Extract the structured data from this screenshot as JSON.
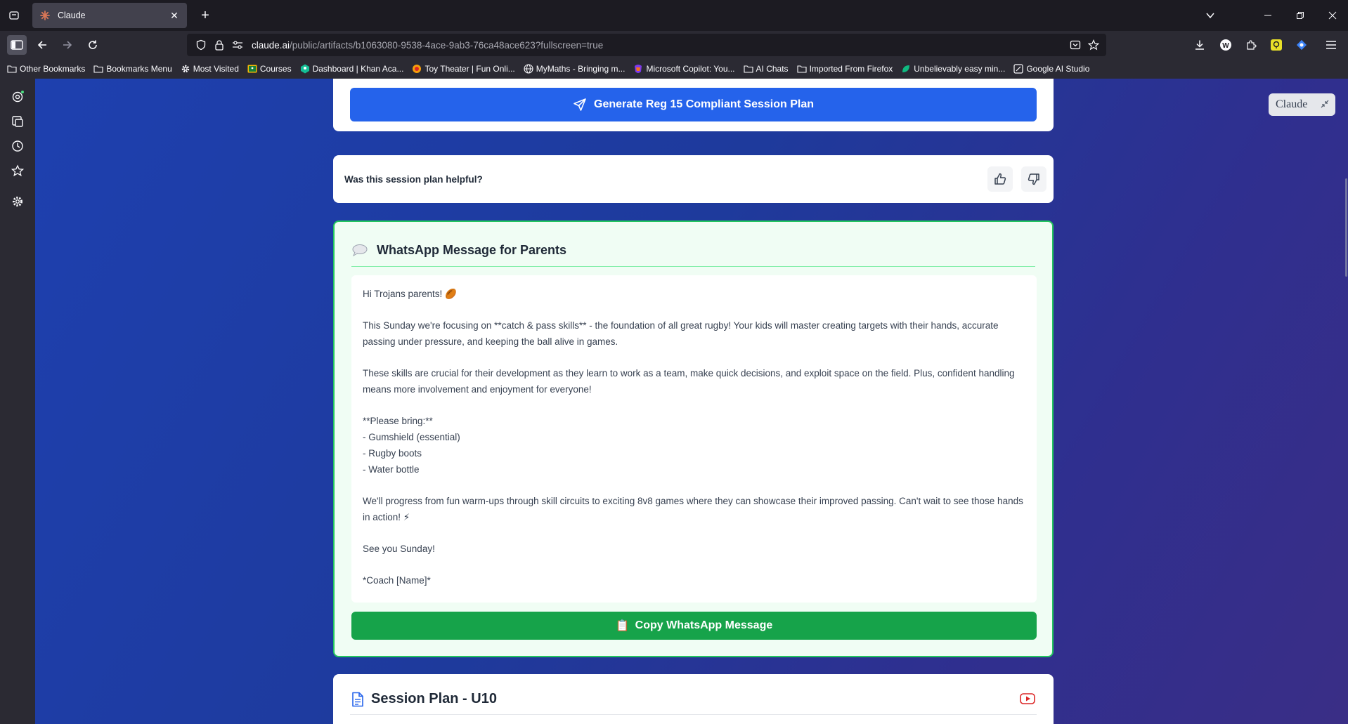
{
  "browser": {
    "tab_title": "Claude",
    "url_host": "claude.ai",
    "url_path": "/public/artifacts/b1063080-9538-4ace-9ab3-76ca48ace623?fullscreen=true",
    "bookmarks": [
      "Other Bookmarks",
      "Bookmarks Menu",
      "Most Visited",
      "Courses",
      "Dashboard | Khan Aca...",
      "Toy Theater | Fun Onli...",
      "MyMaths - Bringing m...",
      "Microsoft Copilot: You...",
      "AI Chats",
      "Imported From Firefox",
      "Unbelievably easy min...",
      "Google AI Studio"
    ]
  },
  "artifact": {
    "badge": "Claude",
    "generate_button": "Generate Reg 15 Compliant Session Plan",
    "feedback_question": "Was this session plan helpful?",
    "whatsapp": {
      "title": "WhatsApp Message for Parents",
      "lines": {
        "greeting": "Hi Trojans parents! 🏉",
        "p1": "This Sunday we're focusing on **catch & pass skills** - the foundation of all great rugby! Your kids will master creating targets with their hands, accurate passing under pressure, and keeping the ball alive in games.",
        "p2": "These skills are crucial for their development as they learn to work as a team, make quick decisions, and exploit space on the field. Plus, confident handling means more involvement and enjoyment for everyone!",
        "bring_heading": "**Please bring:**",
        "bring_items": [
          "- Gumshield (essential)",
          "- Rugby boots",
          "- Water bottle"
        ],
        "p3": "We'll progress from fun warm-ups through skill circuits to exciting 8v8 games where they can showcase their improved passing. Can't wait to see those hands in action! ⚡",
        "signoff": "See you Sunday!",
        "coach": "*Coach [Name]*"
      },
      "copy_button": "Copy WhatsApp Message",
      "copy_icon": "📋"
    },
    "session_plan": {
      "title": "Session Plan - U10"
    }
  },
  "colors": {
    "primary_blue": "#2563eb",
    "whatsapp_green": "#16a34a",
    "whatsapp_border": "#22c55e",
    "youtube_red": "#dc2626"
  }
}
